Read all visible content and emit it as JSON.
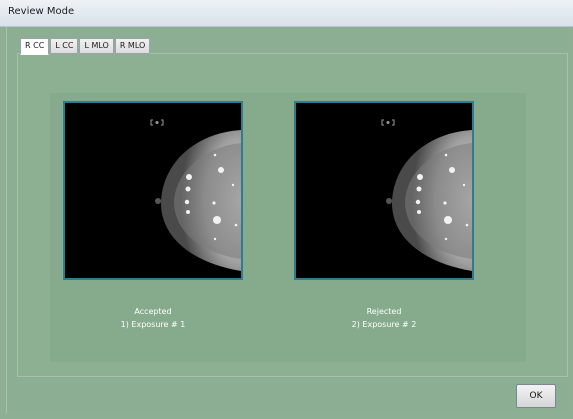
{
  "window": {
    "title": "Review Mode"
  },
  "tabs": [
    {
      "label": "R CC",
      "active": true
    },
    {
      "label": "L CC",
      "active": false
    },
    {
      "label": "L MLO",
      "active": false
    },
    {
      "label": "R MLO",
      "active": false
    }
  ],
  "images": [
    {
      "status": "Accepted",
      "exposure": "1) Exposure # 1"
    },
    {
      "status": "Rejected",
      "exposure": "2) Exposure # 2"
    }
  ],
  "footer": {
    "ok_label": "OK"
  },
  "colors": {
    "background": "#8eaf93",
    "image_border": "#2c7d92"
  }
}
